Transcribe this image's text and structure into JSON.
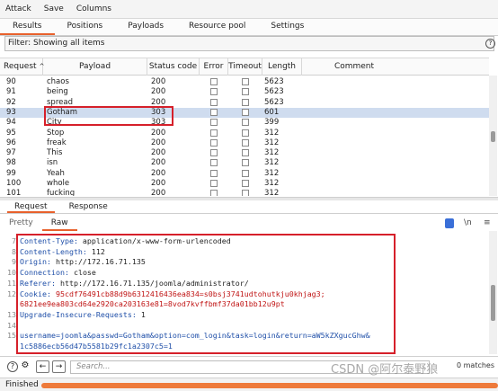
{
  "menu": {
    "items": [
      "Attack",
      "Save",
      "Columns"
    ]
  },
  "tabs": [
    "Results",
    "Positions",
    "Payloads",
    "Resource pool",
    "Settings"
  ],
  "filter": {
    "text": "Filter: Showing all items",
    "help": "?"
  },
  "table": {
    "headers": [
      "Request",
      "Payload",
      "Status code",
      "Error",
      "Timeout",
      "Length",
      "Comment"
    ],
    "sort_indicator": "^",
    "rows": [
      {
        "request": "90",
        "payload": "chaos",
        "status": "200",
        "length": "5623",
        "selected": false
      },
      {
        "request": "91",
        "payload": "being",
        "status": "200",
        "length": "5623",
        "selected": false
      },
      {
        "request": "92",
        "payload": "spread",
        "status": "200",
        "length": "5623",
        "selected": false
      },
      {
        "request": "93",
        "payload": "Gotham",
        "status": "303",
        "length": "601",
        "selected": true
      },
      {
        "request": "94",
        "payload": "City",
        "status": "303",
        "length": "399",
        "selected": false
      },
      {
        "request": "95",
        "payload": "Stop",
        "status": "200",
        "length": "312",
        "selected": false
      },
      {
        "request": "96",
        "payload": "freak",
        "status": "200",
        "length": "312",
        "selected": false
      },
      {
        "request": "97",
        "payload": "This",
        "status": "200",
        "length": "312",
        "selected": false
      },
      {
        "request": "98",
        "payload": "isn",
        "status": "200",
        "length": "312",
        "selected": false
      },
      {
        "request": "99",
        "payload": "Yeah",
        "status": "200",
        "length": "312",
        "selected": false
      },
      {
        "request": "100",
        "payload": "whole",
        "status": "200",
        "length": "312",
        "selected": false
      },
      {
        "request": "101",
        "payload": "fucking",
        "status": "200",
        "length": "312",
        "selected": false
      }
    ]
  },
  "viewer": {
    "tabs": [
      "Request",
      "Response"
    ],
    "subtabs": [
      "Pretty",
      "Raw"
    ],
    "tools": {
      "ln": "\\n",
      "menu": "≡"
    }
  },
  "request_lines": [
    {
      "n": "7",
      "header": "Content-Type:",
      "value": " application/x-www-form-urlencoded"
    },
    {
      "n": "8",
      "header": "Content-Length:",
      "value": " 112"
    },
    {
      "n": "9",
      "header": "Origin:",
      "value": " http://172.16.71.135"
    },
    {
      "n": "10",
      "header": "Connection:",
      "value": " close"
    },
    {
      "n": "11",
      "header": "Referer:",
      "value": " http://172.16.71.135/joomla/administrator/"
    },
    {
      "n": "12",
      "header": "Cookie:",
      "value": " 95cdf76491cb88d9b6312416436ea834=s0bsj3741udtohutkju0khjag3;"
    },
    {
      "n": "",
      "header": "",
      "value": "6821ee9ea803cd64e2920ca203163e81=8vod7kvffbmf37da01bb12u9pt"
    },
    {
      "n": "13",
      "header": "Upgrade-Insecure-Requests:",
      "value": " 1"
    },
    {
      "n": "14",
      "header": "",
      "value": ""
    },
    {
      "n": "15",
      "header": "",
      "value": "username=joomla&passwd=Gotham&option=com_login&task=login&return=aW5kZXgucGhw&"
    },
    {
      "n": "",
      "header": "",
      "value": "1c5886ecb56d47b5581b29fc1a2307c5=1"
    }
  ],
  "bottom": {
    "search_placeholder": "Search...",
    "matches": "0 matches",
    "help": "?",
    "settings": "⚙",
    "back": "←",
    "forward": "→"
  },
  "status": {
    "text": "Finished",
    "progress": 1.0
  },
  "watermark": "CSDN @阿尔泰野狼",
  "colors": {
    "accent": "#e8612c",
    "highlight": "#d6202a",
    "selected_row": "#cfdcef",
    "header_key": "#1f4fa8",
    "cookie": "#c01515"
  }
}
